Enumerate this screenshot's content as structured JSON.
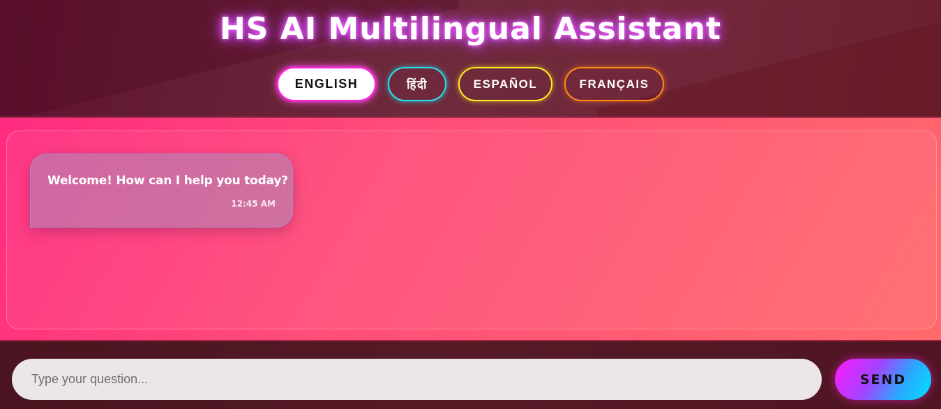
{
  "header": {
    "title": "HS AI Multilingual Assistant",
    "languages": [
      {
        "label": "ENGLISH",
        "active": true,
        "color": "#ff22dd"
      },
      {
        "label": "हिंदी",
        "active": false,
        "color": "#27e3ee"
      },
      {
        "label": "ESPAÑOL",
        "active": false,
        "color": "#ffee22"
      },
      {
        "label": "FRANÇAIS",
        "active": false,
        "color": "#ff8a18"
      }
    ]
  },
  "chat": {
    "messages": [
      {
        "text": "Welcome! How can I help you today?",
        "time": "12:45 AM",
        "sender": "bot"
      }
    ]
  },
  "input": {
    "placeholder": "Type your question...",
    "value": "",
    "send_label": "SEND"
  }
}
